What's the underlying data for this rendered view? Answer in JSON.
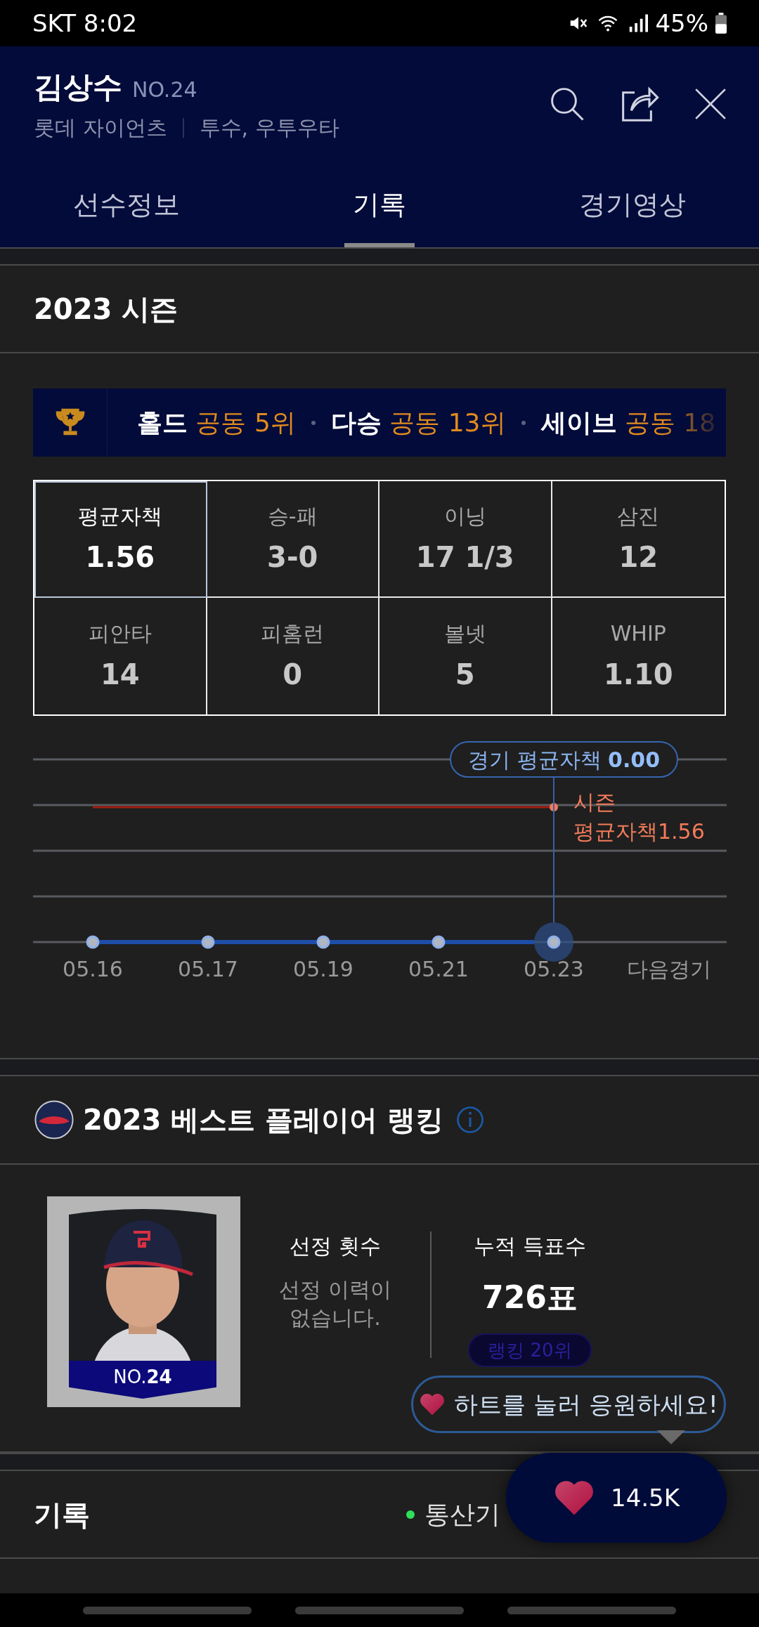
{
  "status_bar": {
    "carrier_time": "SKT 8:02",
    "battery": "45%"
  },
  "player": {
    "name": "김상수",
    "number": "NO.24",
    "team": "롯데 자이언츠",
    "position": "투수, 우투우타"
  },
  "tabs": [
    {
      "label": "선수정보",
      "selected": false
    },
    {
      "label": "기록",
      "selected": true
    },
    {
      "label": "경기영상",
      "selected": false
    }
  ],
  "season": {
    "title": "2023 시즌",
    "rankings": [
      {
        "stat": "홀드",
        "rank": "공동 5위"
      },
      {
        "stat": "다승",
        "rank": "공동 13위"
      },
      {
        "stat": "세이브",
        "rank": "공동 18"
      }
    ],
    "stats": [
      {
        "label": "평균자책",
        "value": "1.56",
        "selected": true
      },
      {
        "label": "승-패",
        "value": "3-0",
        "selected": false
      },
      {
        "label": "이닝",
        "value": "17 1/3",
        "selected": false
      },
      {
        "label": "삼진",
        "value": "12",
        "selected": false
      },
      {
        "label": "피안타",
        "value": "14",
        "selected": false
      },
      {
        "label": "피홈런",
        "value": "0",
        "selected": false
      },
      {
        "label": "볼넷",
        "value": "5",
        "selected": false
      },
      {
        "label": "WHIP",
        "value": "1.10",
        "selected": false
      }
    ],
    "chart": {
      "tooltip_label": "경기 평균자책",
      "tooltip_value": "0.00",
      "season_label": "시즌 평균자책1.56",
      "x_labels": [
        "05.16",
        "05.17",
        "05.19",
        "05.21",
        "05.23",
        "다음경기"
      ]
    }
  },
  "best_player": {
    "title": "2023 베스트 플레이어 랭킹",
    "card_number": "NO.**24**",
    "selection_label": "선정 횟수",
    "selection_text": "선정 이력이 없습니다.",
    "votes_label": "누적 득표수",
    "votes": "726표",
    "rank_badge": "랭킹 20위"
  },
  "cheer": {
    "prompt": "하트를 눌러 응원하세요!",
    "count": "14.5K"
  },
  "records": {
    "title": "기록",
    "filters": [
      {
        "label": "통산기",
        "selected": true
      }
    ]
  }
}
